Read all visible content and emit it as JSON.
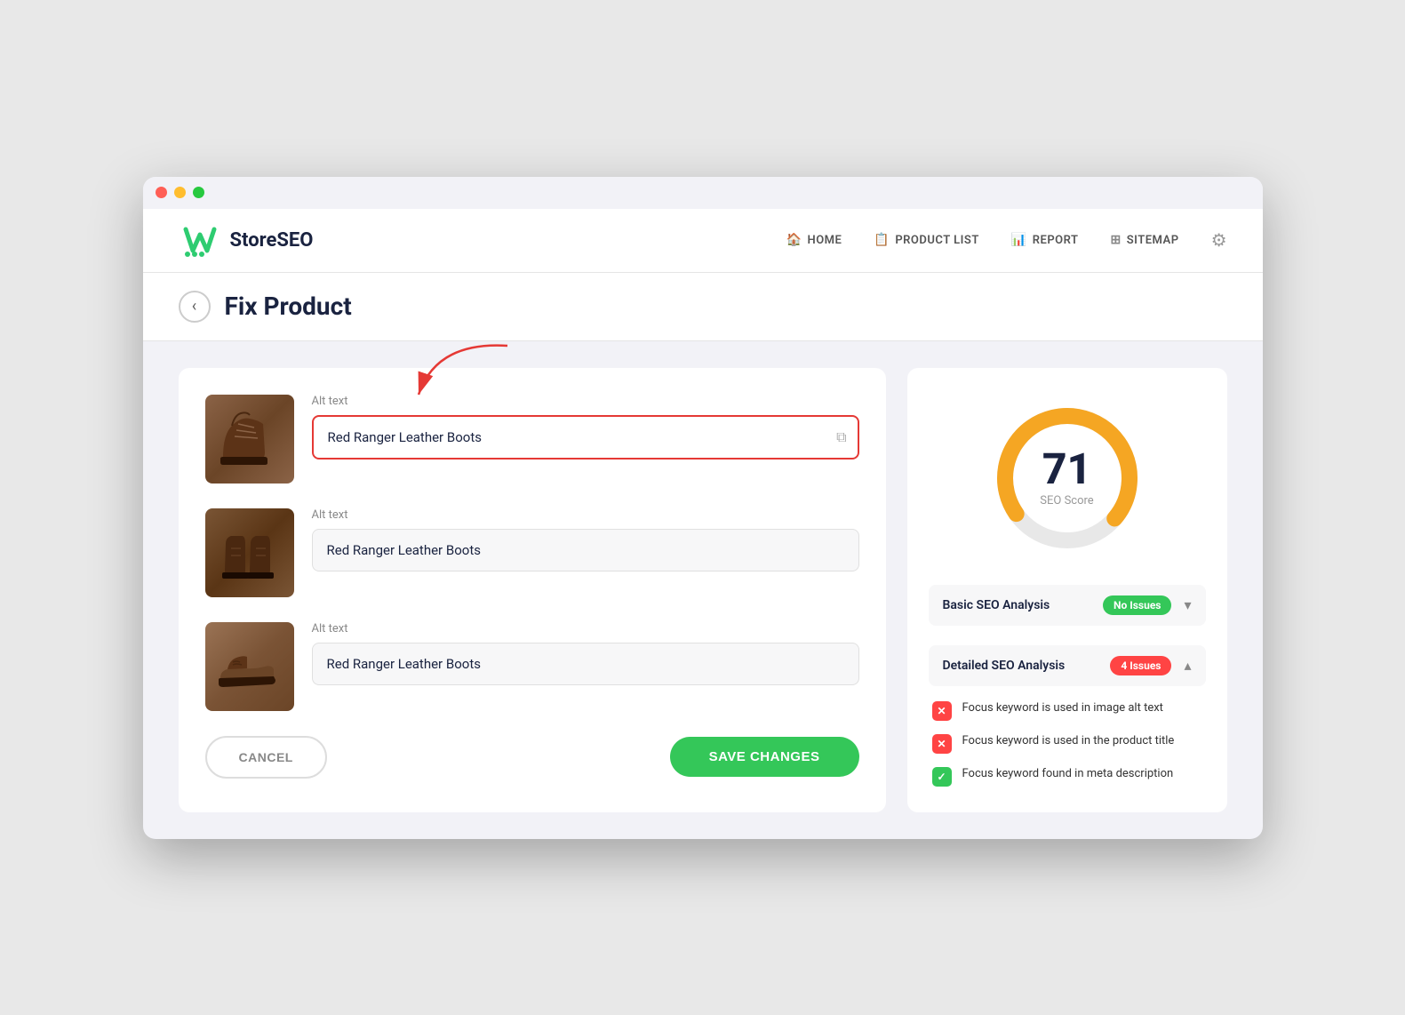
{
  "window": {
    "title": "StoreSEO - Fix Product"
  },
  "navbar": {
    "logo_text_store": "Store",
    "logo_text_seo": "SEO",
    "links": [
      {
        "id": "home",
        "icon": "🏠",
        "label": "HOME"
      },
      {
        "id": "product-list",
        "icon": "📋",
        "label": "PRODUCT LIST"
      },
      {
        "id": "report",
        "icon": "📊",
        "label": "REPORT"
      },
      {
        "id": "sitemap",
        "icon": "⊞",
        "label": "SITEMAP"
      }
    ]
  },
  "page_header": {
    "title": "Fix Product",
    "back_label": "‹"
  },
  "products": [
    {
      "id": 1,
      "alt_label": "Alt text",
      "alt_value": "Red Ranger Leather Boots",
      "highlighted": true
    },
    {
      "id": 2,
      "alt_label": "Alt text",
      "alt_value": "Red Ranger Leather Boots",
      "highlighted": false
    },
    {
      "id": 3,
      "alt_label": "Alt text",
      "alt_value": "Red Ranger Leather Boots",
      "highlighted": false
    }
  ],
  "buttons": {
    "cancel": "CANCEL",
    "save": "SAVE CHANGES"
  },
  "seo_score": {
    "value": 71,
    "label": "SEO Score",
    "percentage": 71
  },
  "seo_sections": [
    {
      "id": "basic",
      "title": "Basic SEO Analysis",
      "badge_text": "No Issues",
      "badge_color": "green",
      "expanded": false
    },
    {
      "id": "detailed",
      "title": "Detailed SEO Analysis",
      "badge_text": "4 Issues",
      "badge_color": "red",
      "expanded": true
    }
  ],
  "issues": [
    {
      "id": 1,
      "status": "fail",
      "text": "Focus keyword is used in image alt text"
    },
    {
      "id": 2,
      "status": "fail",
      "text": "Focus keyword is used in the product title"
    },
    {
      "id": 3,
      "status": "pass",
      "text": "Focus keyword found in meta description"
    }
  ]
}
